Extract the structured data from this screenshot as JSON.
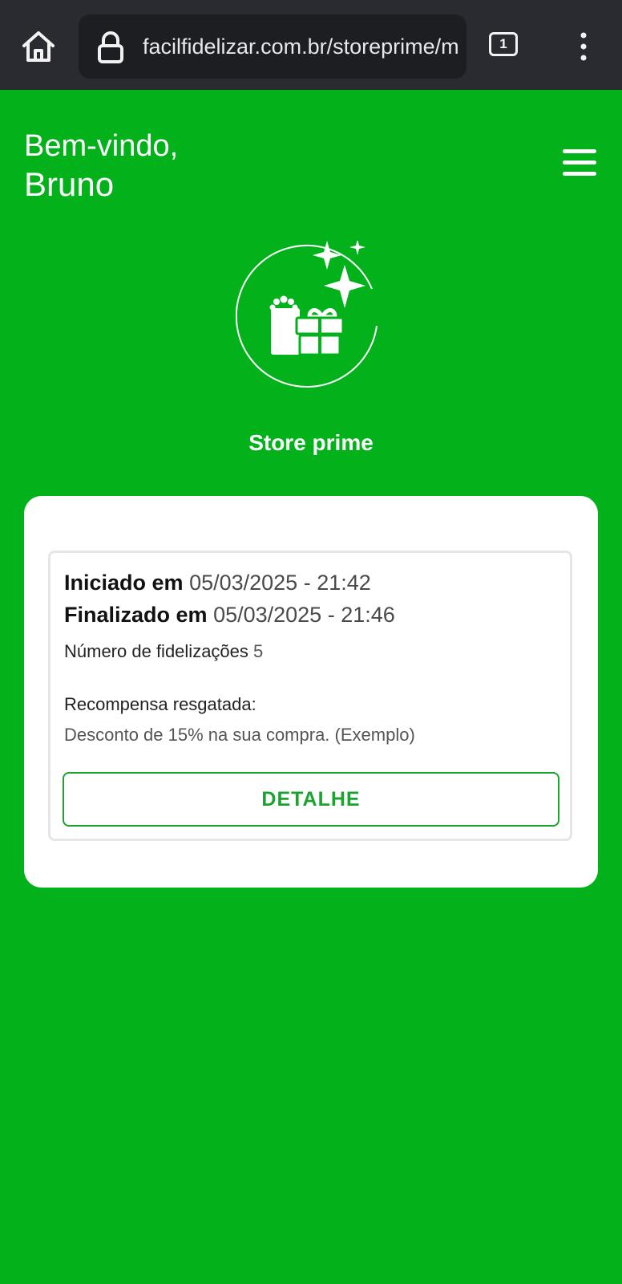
{
  "browser": {
    "url": "facilfidelizar.com.br/storeprime/m",
    "tab_count": "1",
    "icons": [
      "home-icon",
      "lock-icon",
      "tabs-icon",
      "more-vert-icon"
    ]
  },
  "header": {
    "greeting": "Bem-vindo,",
    "user_name": "Bruno",
    "menu_icon": "hamburger-menu-icon"
  },
  "store": {
    "logo_icon": "gift-sparkles-icon",
    "name": "Store prime"
  },
  "record": {
    "started_label": "Iniciado em",
    "started_value": "05/03/2025 - 21:42",
    "finished_label": "Finalizado em",
    "finished_value": "05/03/2025 - 21:46",
    "count_label": "Número de fidelizações",
    "count_value": "5",
    "reward_label": "Recompensa resgatada:",
    "reward_value": "Desconto de 15% na sua compra. (Exemplo)",
    "detail_button": "DETALHE"
  },
  "colors": {
    "background": "#03b21b",
    "accent": "#1aa32f",
    "browser_bar": "#2a2b30"
  }
}
